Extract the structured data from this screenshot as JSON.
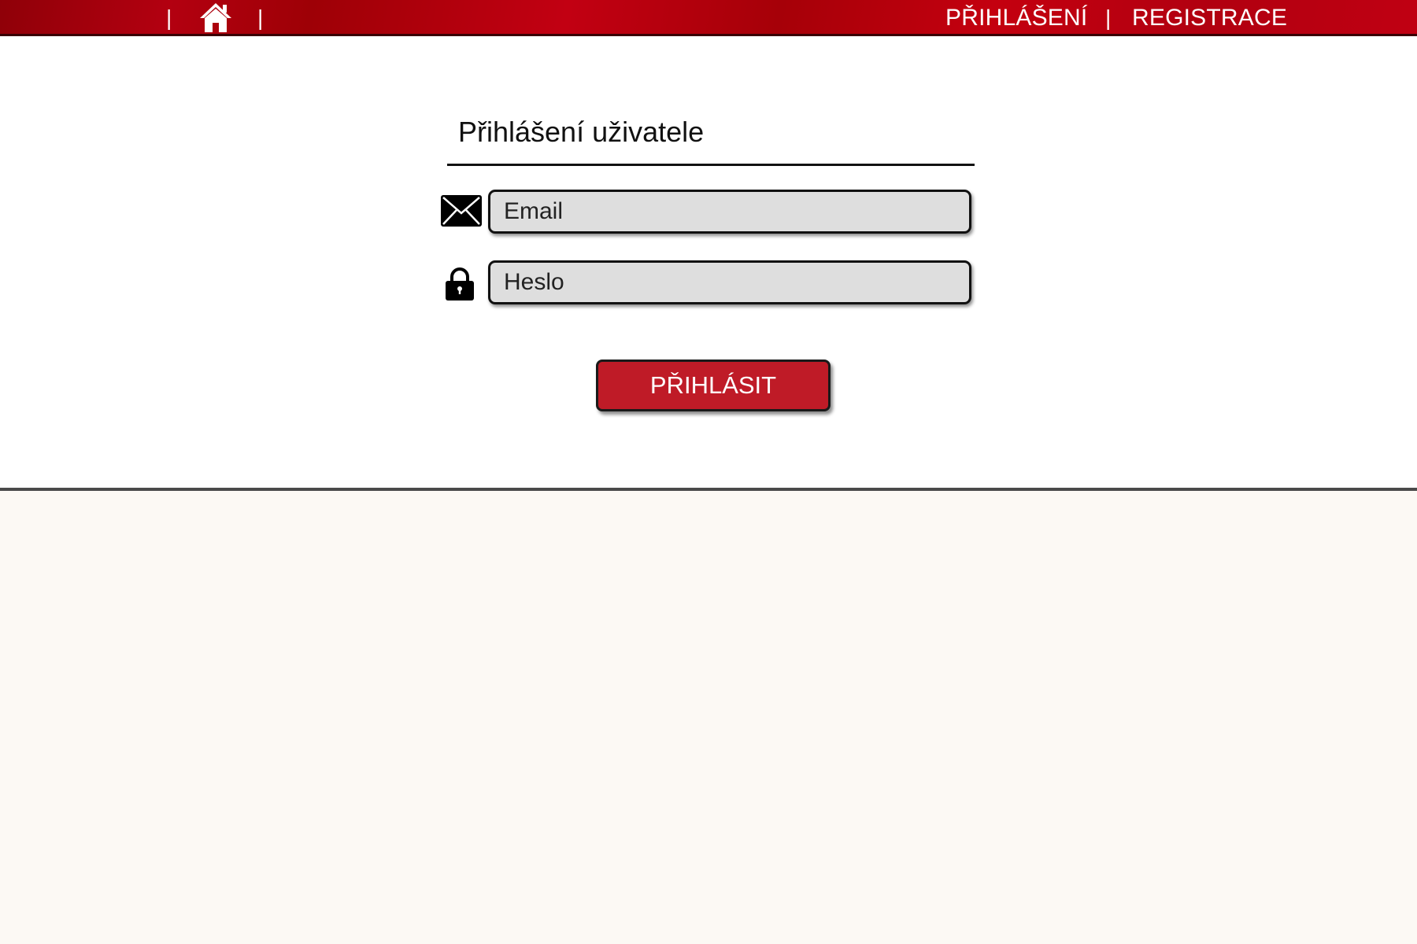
{
  "header": {
    "separator": "|",
    "home_icon": "home-icon",
    "nav": {
      "login": "PŘIHLÁŠENÍ",
      "register": "REGISTRACE"
    },
    "bar_color": "#b30010"
  },
  "login_form": {
    "title": "Přihlášení uživatele",
    "email": {
      "icon": "envelope-icon",
      "placeholder": "Email",
      "value": ""
    },
    "password": {
      "icon": "lock-icon",
      "placeholder": "Heslo",
      "value": ""
    },
    "submit_label": "PŘIHLÁSIT",
    "submit_color": "#bf1b27"
  }
}
